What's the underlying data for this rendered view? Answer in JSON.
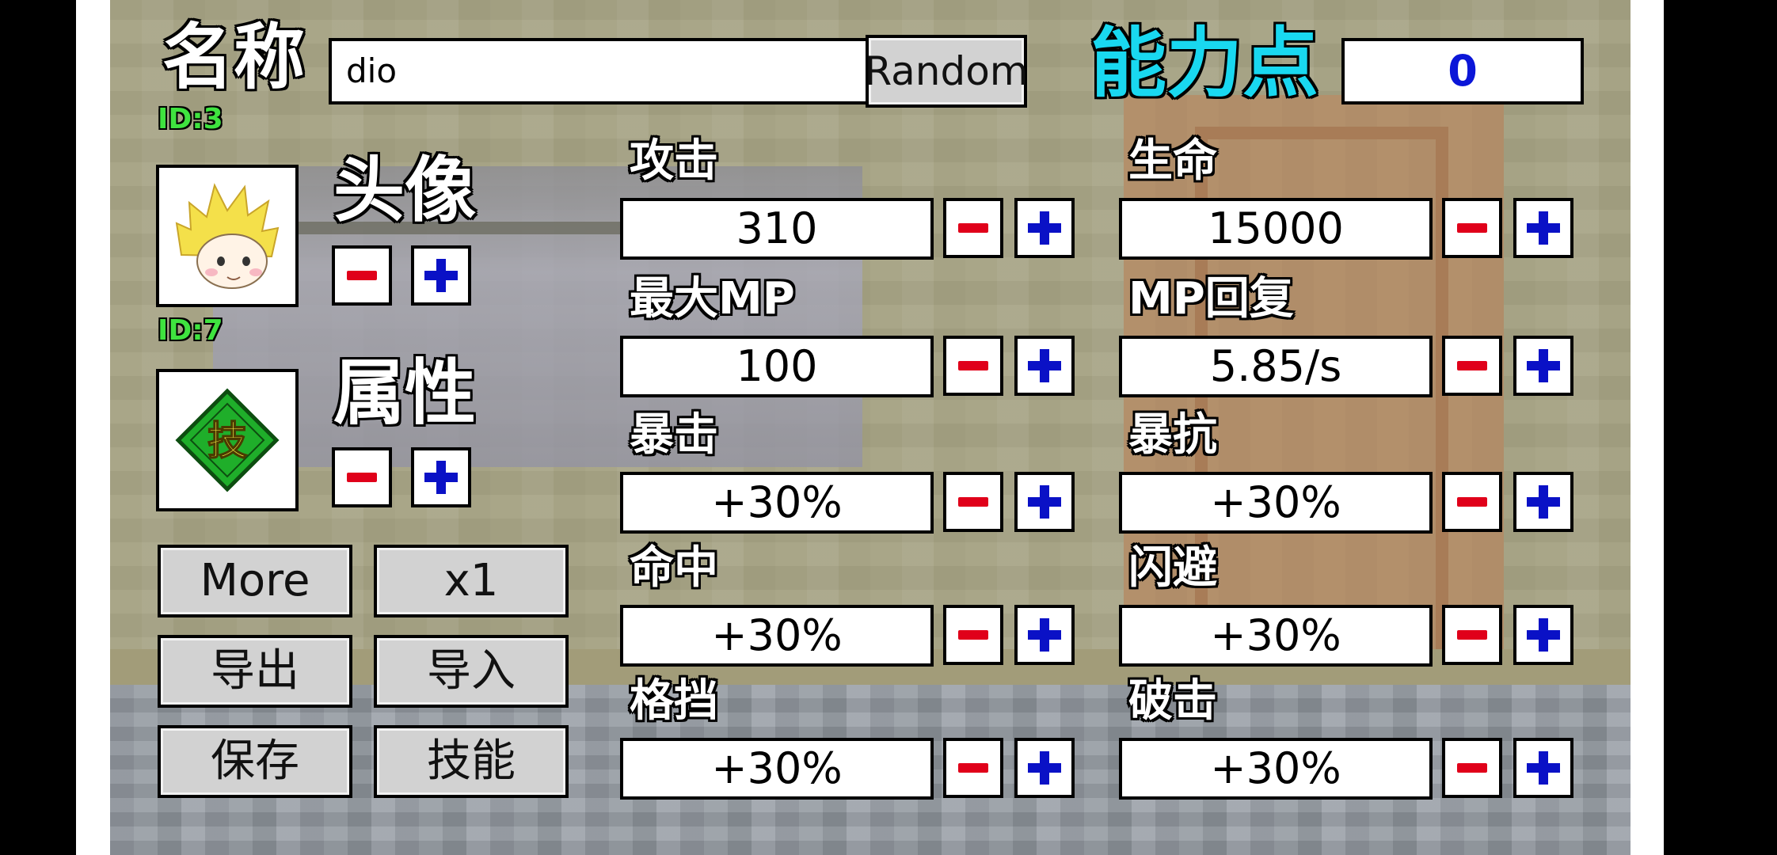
{
  "header": {
    "name_label": "名称",
    "name_value": "dio",
    "random_label": "Random",
    "points_label": "能力点",
    "points_value": "0",
    "name_id": "ID:3"
  },
  "avatar": {
    "label": "头像",
    "id": "ID:7",
    "icon": "blond-hair-character-portrait"
  },
  "attribute": {
    "label": "属性",
    "badge_text": "技",
    "icon": "green-diamond-badge"
  },
  "buttons": {
    "more": "More",
    "multiplier": "x1",
    "export": "导出",
    "import": "导入",
    "save": "保存",
    "skills": "技能"
  },
  "stats": [
    {
      "label": "攻击",
      "value": "310"
    },
    {
      "label": "生命",
      "value": "15000"
    },
    {
      "label": "最大MP",
      "value": "100"
    },
    {
      "label": "MP回复",
      "value": "5.85/s"
    },
    {
      "label": "暴击",
      "value": "+30%"
    },
    {
      "label": "暴抗",
      "value": "+30%"
    },
    {
      "label": "命中",
      "value": "+30%"
    },
    {
      "label": "闪避",
      "value": "+30%"
    },
    {
      "label": "格挡",
      "value": "+30%"
    },
    {
      "label": "破击",
      "value": "+30%"
    }
  ],
  "colors": {
    "points_label": "#19d8f0",
    "points_value": "#0b16d8",
    "id_label": "#3fe33f",
    "minus": "#e0001a",
    "plus": "#0a11c6",
    "button_gray": "#d2d2d2"
  }
}
